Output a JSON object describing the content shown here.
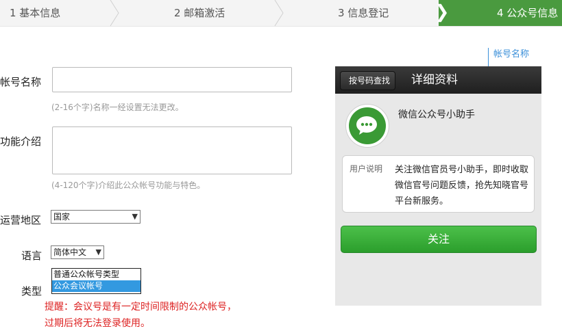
{
  "steps": [
    {
      "label": "1 基本信息"
    },
    {
      "label": "2 邮箱激活"
    },
    {
      "label": "3 信息登记"
    },
    {
      "label": "4 公众号信息"
    }
  ],
  "form": {
    "name_label": "帐号名称",
    "name_value": "",
    "name_hint": "(2-16个字)名称一经设置无法更改。",
    "intro_label": "功能介绍",
    "intro_value": "",
    "intro_hint": "(4-120个字)介绍此公众帐号功能与特色。",
    "region_label": "运营地区",
    "region_value": "国家",
    "lang_label": "语言",
    "lang_value": "简体中文",
    "type_label": "类型",
    "type_options": [
      "普通公众帐号类型",
      "公众会议帐号"
    ],
    "type_selected": "公众会议帐号",
    "warning": "提醒：会议号是有一定时间限制的公众帐号，过期后将无法登录使用。"
  },
  "preview": {
    "annotation": "帐号名称",
    "back_label": "按号码查找",
    "title": "详细资料",
    "account_name": "微信公众号小助手",
    "desc_label": "用户说明",
    "desc_text": "关注微信官员号小助手，即时收取微信官号问题反馈，抢先知晓官号平台新服务。",
    "follow_label": "关注"
  },
  "colors": {
    "active_step": "#4a9a3f",
    "annotation": "#3a8fd9",
    "warning": "#dd2222",
    "follow_button": "#2b9e2c"
  }
}
